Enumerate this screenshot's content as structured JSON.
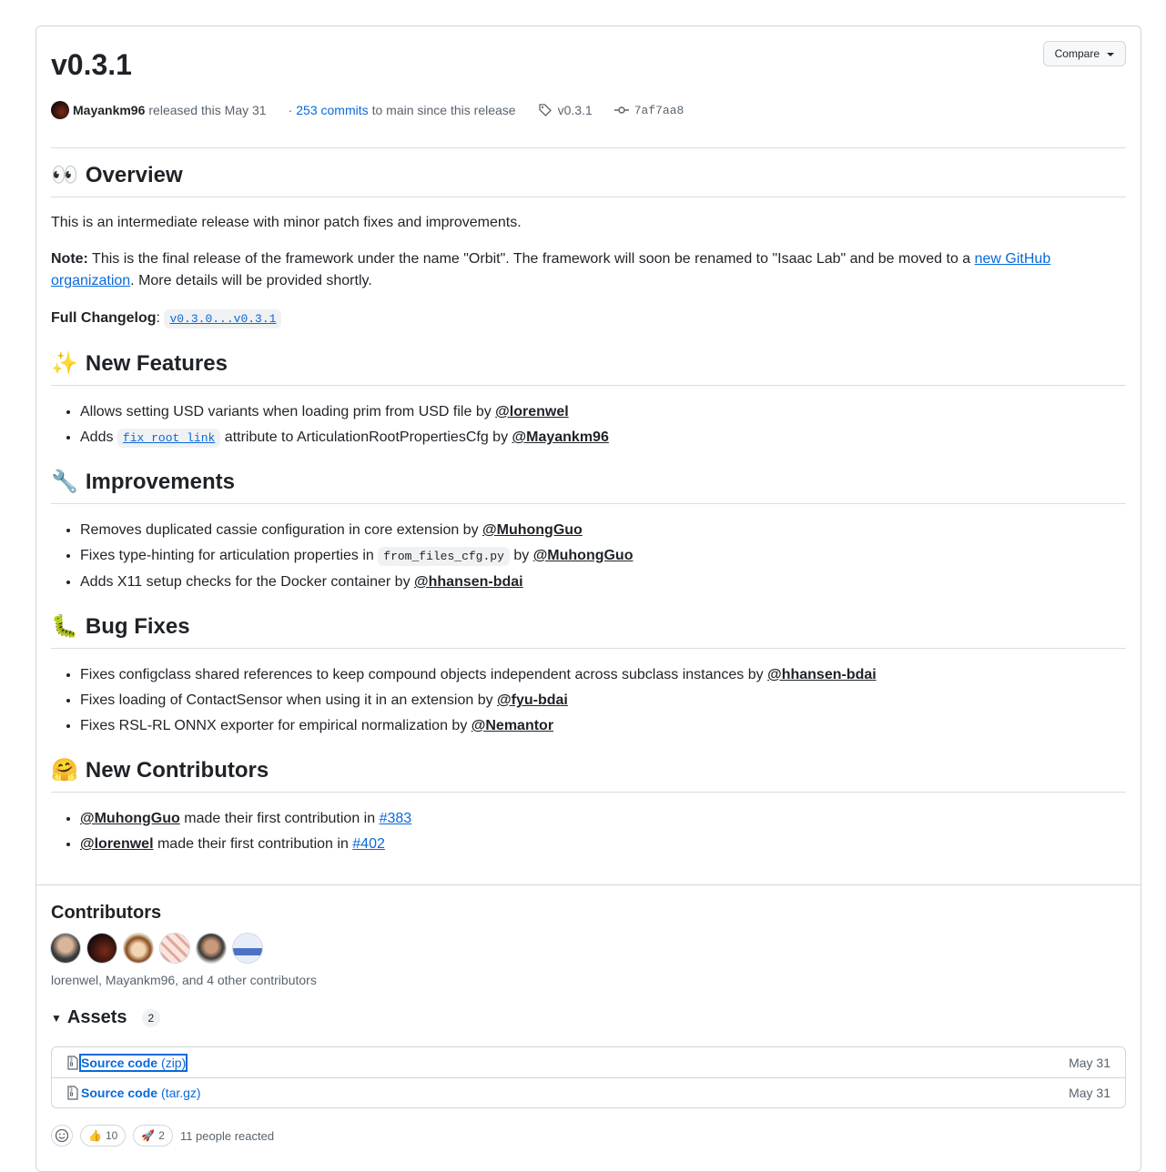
{
  "release": {
    "title": "v0.3.1",
    "compare_label": "Compare",
    "author": "Mayankm96",
    "released_text": "released this May 31",
    "commits_link": "253 commits",
    "commits_suffix": "to main since this release",
    "tag": "v0.3.1",
    "commit_sha": "7af7aa8"
  },
  "overview": {
    "heading": "Overview",
    "emoji": "👀",
    "intro": "This is an intermediate release with minor patch fixes and improvements.",
    "note_label": "Note:",
    "note_text": " This is the final release of the framework under the name \"Orbit\". The framework will soon be renamed to \"Isaac Lab\" and be moved to a ",
    "note_link": "new GitHub organization",
    "note_tail": ". More details will be provided shortly.",
    "changelog_label": "Full Changelog",
    "changelog_link": "v0.3.0...v0.3.1"
  },
  "features": {
    "heading": "New Features",
    "emoji": "✨",
    "items": [
      {
        "text": "Allows setting USD variants when loading prim from USD file by ",
        "user": "@lorenwel"
      },
      {
        "pre": "Adds ",
        "code": "fix_root_link",
        "text": " attribute to ArticulationRootPropertiesCfg by ",
        "user": "@Mayankm96"
      }
    ]
  },
  "improvements": {
    "heading": "Improvements",
    "emoji": "🔧",
    "items": [
      {
        "text": "Removes duplicated cassie configuration in core extension by ",
        "user": "@MuhongGuo"
      },
      {
        "pre": "Fixes type-hinting for articulation properties in ",
        "code": "from_files_cfg.py",
        "text": " by ",
        "user": "@MuhongGuo"
      },
      {
        "text": "Adds X11 setup checks for the Docker container by ",
        "user": "@hhansen-bdai"
      }
    ]
  },
  "bugfixes": {
    "heading": "Bug Fixes",
    "emoji": "🐛",
    "items": [
      {
        "text": "Fixes configclass shared references to keep compound objects independent across subclass instances by ",
        "user": "@hhansen-bdai"
      },
      {
        "text": "Fixes loading of ContactSensor when using it in an extension by ",
        "user": "@fyu-bdai"
      },
      {
        "text": "Fixes RSL-RL ONNX exporter for empirical normalization by ",
        "user": "@Nemantor"
      }
    ]
  },
  "new_contributors": {
    "heading": "New Contributors",
    "emoji": "🤗",
    "items": [
      {
        "user": "@MuhongGuo",
        "text": " made their first contribution in ",
        "pr": "#383"
      },
      {
        "user": "@lorenwel",
        "text": " made their first contribution in ",
        "pr": "#402"
      }
    ]
  },
  "contributors": {
    "heading": "Contributors",
    "summary": "lorenwel, Mayankm96, and 4 other contributors"
  },
  "assets": {
    "heading": "Assets",
    "count": "2",
    "items": [
      {
        "name": "Source code",
        "ext": "(zip)",
        "date": "May 31"
      },
      {
        "name": "Source code",
        "ext": "(tar.gz)",
        "date": "May 31"
      }
    ]
  },
  "reactions": {
    "thumbs_count": "10",
    "rocket_count": "2",
    "summary": "11 people reacted"
  }
}
